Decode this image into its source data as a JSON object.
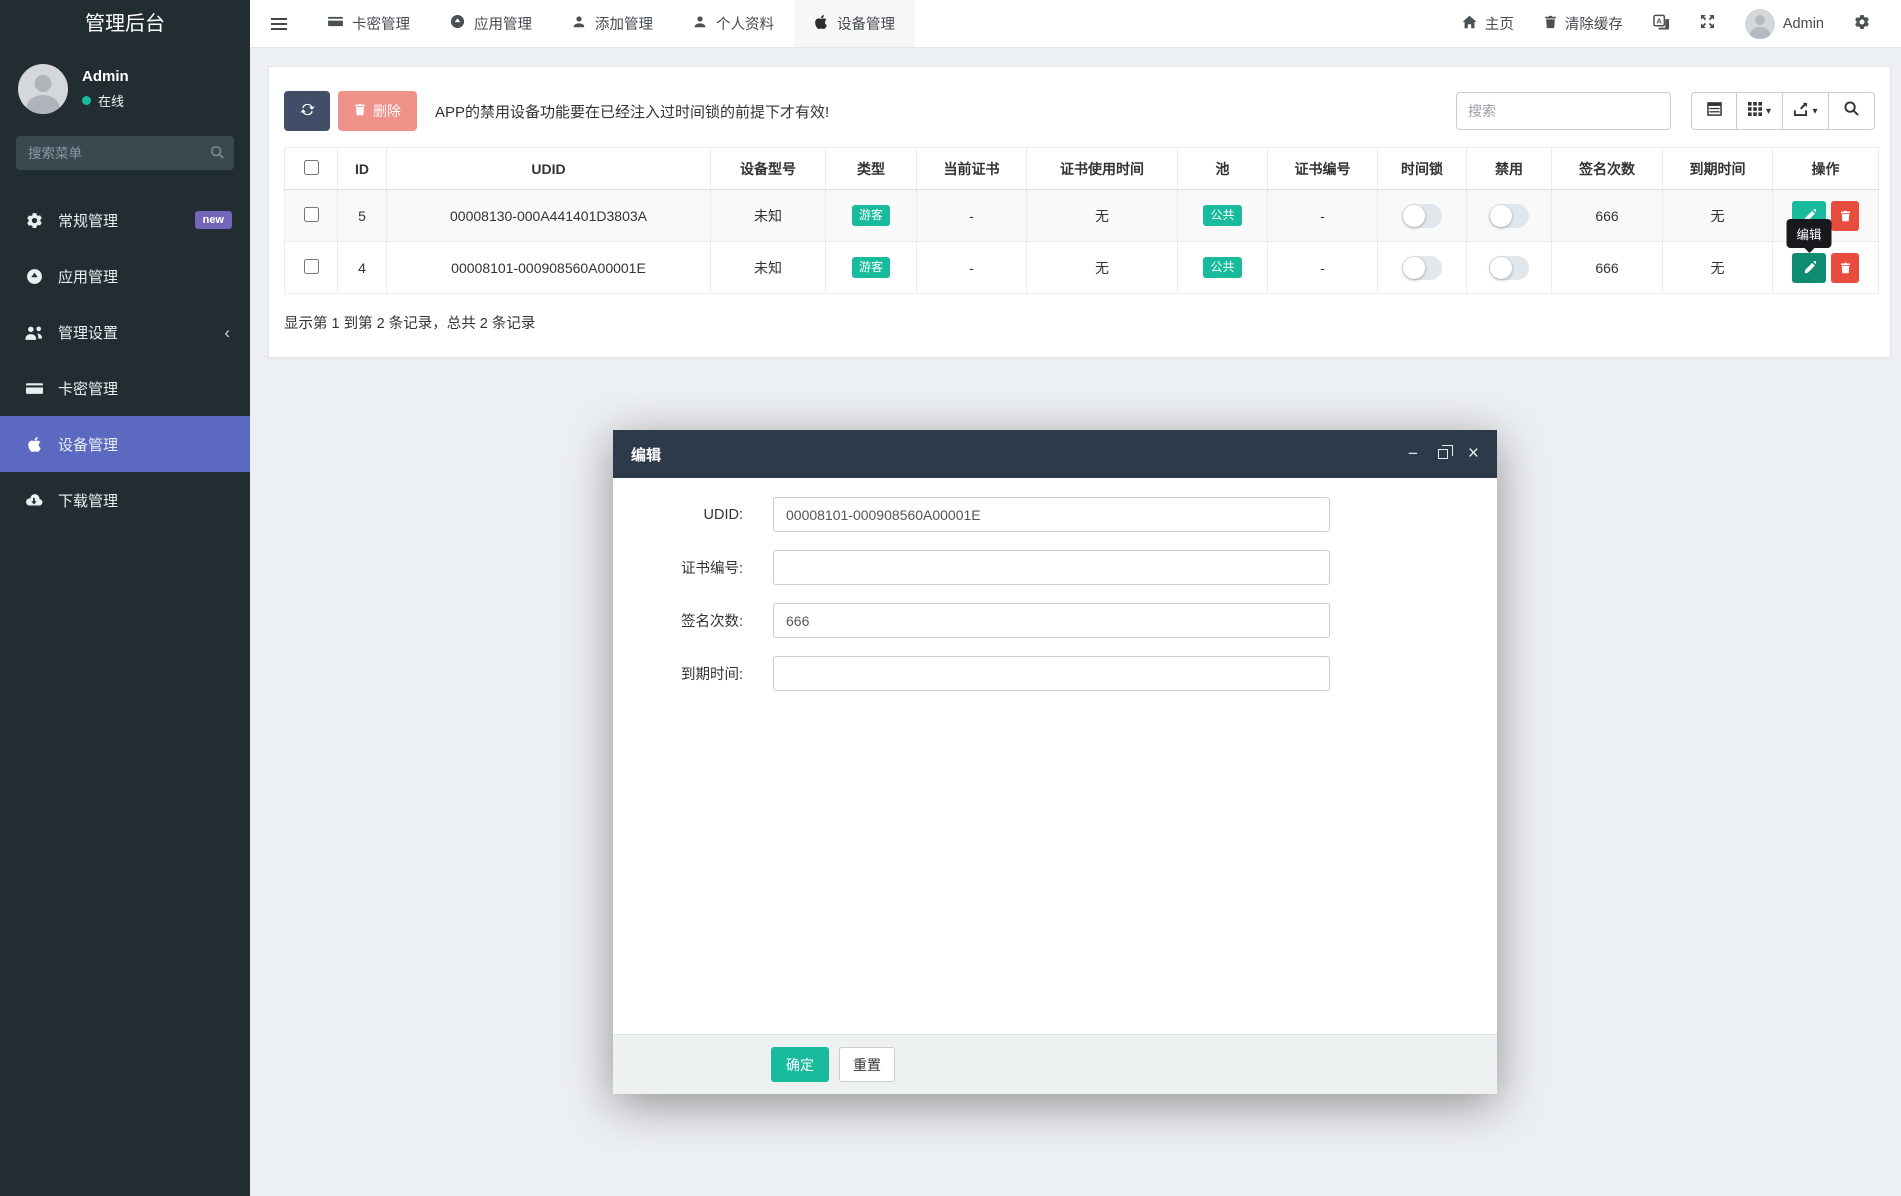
{
  "app": {
    "title": "管理后台"
  },
  "sidebar": {
    "user": {
      "name": "Admin",
      "status": "在线"
    },
    "search_placeholder": "搜索菜单",
    "items": [
      {
        "label": "常规管理",
        "icon": "gears-icon",
        "badge": "new"
      },
      {
        "label": "应用管理",
        "icon": "app-circle-icon"
      },
      {
        "label": "管理设置",
        "icon": "users-icon",
        "chevron": "‹"
      },
      {
        "label": "卡密管理",
        "icon": "credit-card-icon"
      },
      {
        "label": "设备管理",
        "icon": "apple-icon",
        "active": true
      },
      {
        "label": "下载管理",
        "icon": "cloud-download-icon"
      }
    ]
  },
  "topnav": {
    "tabs": [
      {
        "label": "卡密管理",
        "icon": "credit-card-icon"
      },
      {
        "label": "应用管理",
        "icon": "app-circle-icon"
      },
      {
        "label": "添加管理",
        "icon": "user-icon"
      },
      {
        "label": "个人资料",
        "icon": "user-icon"
      },
      {
        "label": "设备管理",
        "icon": "apple-icon",
        "active": true
      }
    ],
    "right": {
      "home": "主页",
      "clear_cache": "清除缓存",
      "user": "Admin"
    }
  },
  "toolbar": {
    "delete_label": "删除",
    "notice": "APP的禁用设备功能要在已经注入过时间锁的前提下才有效!",
    "search_placeholder": "搜索"
  },
  "table": {
    "headers": [
      "ID",
      "UDID",
      "设备型号",
      "类型",
      "当前证书",
      "证书使用时间",
      "池",
      "证书编号",
      "时间锁",
      "禁用",
      "签名次数",
      "到期时间",
      "操作"
    ],
    "rows": [
      {
        "id": "5",
        "udid": "00008130-000A441401D3803A",
        "model": "未知",
        "type": "游客",
        "cert": "-",
        "cert_time": "无",
        "pool": "公共",
        "cert_no": "-",
        "timelock": "off",
        "disabled": "off",
        "sign_count": "666",
        "expire": "无"
      },
      {
        "id": "4",
        "udid": "00008101-000908560A00001E",
        "model": "未知",
        "type": "游客",
        "cert": "-",
        "cert_time": "无",
        "pool": "公共",
        "cert_no": "-",
        "timelock": "off",
        "disabled": "off",
        "sign_count": "666",
        "expire": "无"
      }
    ],
    "summary": "显示第 1 到第 2 条记录，总共 2 条记录"
  },
  "tooltip": {
    "label": "编辑"
  },
  "modal": {
    "title": "编辑",
    "fields": [
      {
        "label": "UDID:",
        "value": "00008101-000908560A00001E"
      },
      {
        "label": "证书编号:",
        "value": ""
      },
      {
        "label": "签名次数:",
        "value": "666"
      },
      {
        "label": "到期时间:",
        "value": ""
      }
    ],
    "confirm_label": "确定",
    "reset_label": "重置"
  },
  "colors": {
    "sidebar_bg": "#222d32",
    "sidebar_active": "#5b69c0",
    "badge_new": "#7266ba",
    "accent_teal": "#18bc9c",
    "danger_red": "#e74c3c",
    "delete_btn": "#f0918a",
    "refresh_btn": "#404e67",
    "modal_header": "#2d3a4a"
  }
}
